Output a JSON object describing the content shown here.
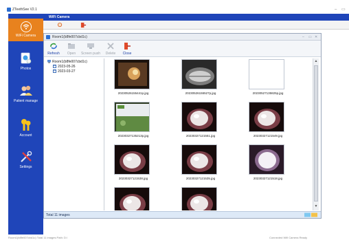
{
  "app": {
    "title": "ZTeethSee V2.1",
    "controls": [
      "–",
      "▭"
    ]
  },
  "sidebar": {
    "items": [
      {
        "label": "WiFi Camera",
        "icon": "wifi-icon",
        "active": true
      },
      {
        "label": "Photos",
        "icon": "photos-icon",
        "active": false
      },
      {
        "label": "Patient manage",
        "icon": "patient-icon",
        "active": false
      },
      {
        "label": "Account",
        "icon": "keys-icon",
        "active": false
      },
      {
        "label": "Settings",
        "icon": "tools-icon",
        "active": false
      }
    ]
  },
  "main": {
    "band_title": "WiFi Camera"
  },
  "window": {
    "title": "Room1(b8fe007cbd1c)",
    "controls": [
      "–",
      "▭",
      "✕"
    ]
  },
  "toolbar": {
    "refresh": "Refresh",
    "open": "Open",
    "screen_push": "Screen push",
    "delete": "Delete",
    "close": "Close"
  },
  "tree": {
    "root": "Room1(b8fe007cbd1c)",
    "dates": [
      "2023-05-26",
      "2023-03-27"
    ]
  },
  "thumbnails": [
    {
      "name": "20230526155441p.jpg",
      "kind": "warm"
    },
    {
      "name": "20230526155527p.jpg",
      "kind": "xray"
    },
    {
      "name": "20230527135825p.jpg",
      "kind": "blank"
    },
    {
      "name": "20230327135213p.jpg",
      "kind": "screen"
    },
    {
      "name": "20230327121551.jpg",
      "kind": "tooth"
    },
    {
      "name": "20230327121549.jpg",
      "kind": "tooth"
    },
    {
      "name": "20230327121538.jpg",
      "kind": "tooth"
    },
    {
      "name": "20230327121535.jpg",
      "kind": "tooth"
    },
    {
      "name": "20230327121518.jpg",
      "kind": "tooth-bright"
    },
    {
      "name": "",
      "kind": "tooth"
    },
    {
      "name": "",
      "kind": "tooth"
    }
  ],
  "status": {
    "text": "Total 11 images"
  },
  "app_status": {
    "left": "Room1(b8fe007cbd1c)  Total 11 images  Path: D:\\",
    "right": "Connected  Wifi Camera  Ready"
  },
  "colors": {
    "sidebar": "#1f45b9",
    "active": "#e8821e",
    "status": "#dde9f7"
  }
}
